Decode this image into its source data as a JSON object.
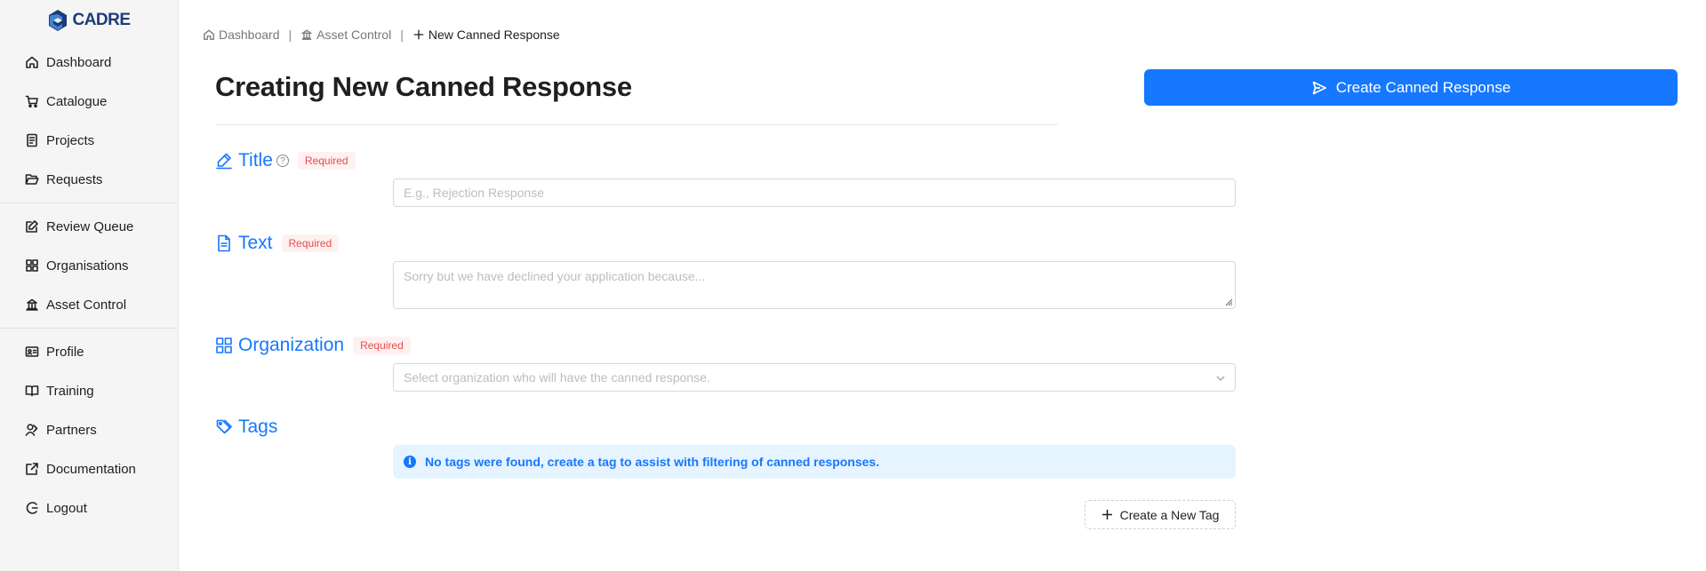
{
  "brand": {
    "name": "CADRE",
    "colors": {
      "accent": "#1677ff",
      "logo": "#1d3b7a",
      "required": "#e54d4d"
    }
  },
  "sidebar": {
    "groups": [
      {
        "items": [
          {
            "label": "Dashboard",
            "icon": "home-icon"
          },
          {
            "label": "Catalogue",
            "icon": "cart-icon"
          },
          {
            "label": "Projects",
            "icon": "document-icon"
          },
          {
            "label": "Requests",
            "icon": "folder-open-icon"
          }
        ]
      },
      {
        "items": [
          {
            "label": "Review Queue",
            "icon": "edit-square-icon"
          },
          {
            "label": "Organisations",
            "icon": "grid-icon"
          },
          {
            "label": "Asset Control",
            "icon": "bank-icon"
          }
        ]
      },
      {
        "items": [
          {
            "label": "Profile",
            "icon": "idcard-icon"
          },
          {
            "label": "Training",
            "icon": "book-icon"
          },
          {
            "label": "Partners",
            "icon": "user-switch-icon"
          },
          {
            "label": "Documentation",
            "icon": "external-link-icon"
          },
          {
            "label": "Logout",
            "icon": "logout-icon"
          }
        ]
      }
    ]
  },
  "breadcrumb": {
    "items": [
      {
        "label": "Dashboard",
        "icon": "home-icon"
      },
      {
        "label": "Asset Control",
        "icon": "bank-icon"
      },
      {
        "label": "New Canned Response",
        "icon": "plus-icon"
      }
    ],
    "separator": "|"
  },
  "page": {
    "title": "Creating New Canned Response"
  },
  "actions": {
    "create_label": "Create Canned Response"
  },
  "form": {
    "title": {
      "label": "Title",
      "badge": "Required",
      "placeholder": "E.g., Rejection Response",
      "help": "?"
    },
    "text": {
      "label": "Text",
      "badge": "Required",
      "placeholder": "Sorry but we have declined your application because..."
    },
    "organization": {
      "label": "Organization",
      "badge": "Required",
      "placeholder": "Select organization who will have the canned response."
    },
    "tags": {
      "label": "Tags",
      "info_icon": "i",
      "empty_message": "No tags were found, create a tag to assist with filtering of canned responses.",
      "create_label": "Create a New Tag"
    }
  }
}
